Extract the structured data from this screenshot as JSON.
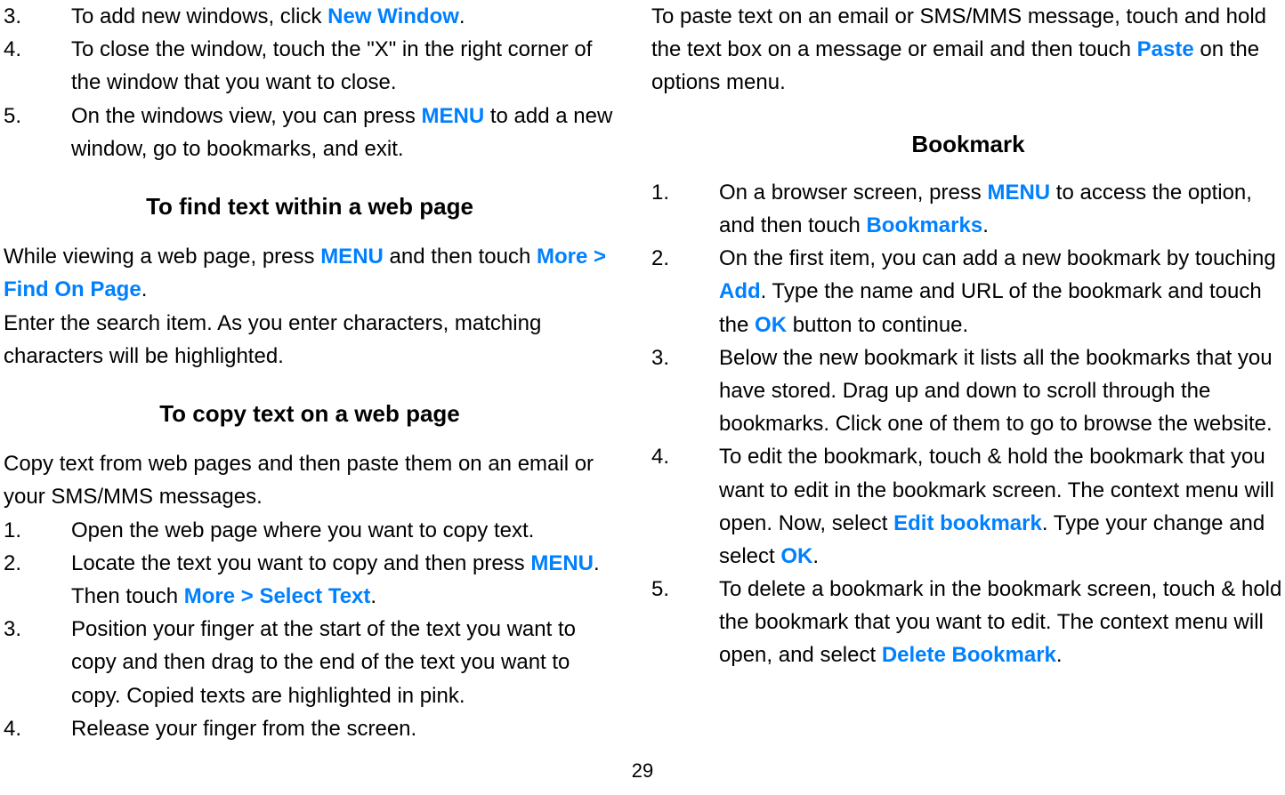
{
  "left": {
    "items_top": [
      {
        "num": "3.",
        "parts": [
          {
            "t": "To add new windows, click "
          },
          {
            "t": "New Window",
            "cls": "blue"
          },
          {
            "t": "."
          }
        ]
      },
      {
        "num": "4.",
        "parts": [
          {
            "t": "To close the window, touch the \"X\" in the right corner of the window that you want to close."
          }
        ]
      },
      {
        "num": "5.",
        "parts": [
          {
            "t": "On the windows view, you can press "
          },
          {
            "t": "MENU",
            "cls": "blue"
          },
          {
            "t": " to add a new window, go to bookmarks, and exit."
          }
        ]
      }
    ],
    "h_find": "To find text within a web page",
    "find_para1": [
      {
        "t": "While viewing a web page, press "
      },
      {
        "t": "MENU",
        "cls": "blue"
      },
      {
        "t": " and then touch "
      },
      {
        "t": "More > Find On Page",
        "cls": "blue"
      },
      {
        "t": "."
      }
    ],
    "find_para2": [
      {
        "t": "Enter the search item. As you enter characters, matching characters will be highlighted."
      }
    ],
    "h_copy": "To copy text on a web page",
    "copy_intro": [
      {
        "t": "Copy text from web pages and then paste them on an email or your SMS/MMS messages."
      }
    ],
    "copy_items": [
      {
        "num": "1.",
        "parts": [
          {
            "t": "Open the web page where you want to copy text."
          }
        ]
      },
      {
        "num": "2.",
        "parts": [
          {
            "t": "Locate the text you want to copy and then press "
          },
          {
            "t": "MENU",
            "cls": "blue"
          },
          {
            "t": ". Then touch "
          },
          {
            "t": "More > Select Text",
            "cls": "blue"
          },
          {
            "t": "."
          }
        ]
      },
      {
        "num": "3.",
        "parts": [
          {
            "t": "Position your finger at the start of the text you want to copy and then drag to the end of the text you want to copy. Copied texts are highlighted in pink."
          }
        ]
      },
      {
        "num": "4.",
        "parts": [
          {
            "t": "Release your finger from the screen."
          }
        ]
      }
    ]
  },
  "right": {
    "paste_para": [
      {
        "t": "To paste text on an email or SMS/MMS message, touch and hold the text box on a message or email and then touch "
      },
      {
        "t": "Paste",
        "cls": "blue"
      },
      {
        "t": " on the options menu."
      }
    ],
    "h_bookmark": "Bookmark",
    "bookmark_items": [
      {
        "num": "1.",
        "parts": [
          {
            "t": "On a browser screen, press "
          },
          {
            "t": "MENU",
            "cls": "blue"
          },
          {
            "t": " to access the option, and then touch "
          },
          {
            "t": "Bookmarks",
            "cls": "blue"
          },
          {
            "t": "."
          }
        ]
      },
      {
        "num": "2.",
        "parts": [
          {
            "t": "On the first item, you can add a new bookmark by touching "
          },
          {
            "t": "Add",
            "cls": "blue"
          },
          {
            "t": ". Type the name and URL of the bookmark and touch the "
          },
          {
            "t": "OK",
            "cls": "blue"
          },
          {
            "t": " button to continue."
          }
        ]
      },
      {
        "num": "3.",
        "parts": [
          {
            "t": "Below the new bookmark it lists all the bookmarks that you have stored. Drag up and down to scroll through the bookmarks. Click one of them to go to browse the website."
          }
        ]
      },
      {
        "num": "4.",
        "parts": [
          {
            "t": "To edit the bookmark, touch & hold the bookmark that you want to edit in the bookmark screen. The context menu will open. Now, select "
          },
          {
            "t": "Edit bookmark",
            "cls": "blue"
          },
          {
            "t": ". Type your change and select "
          },
          {
            "t": "OK",
            "cls": "blue"
          },
          {
            "t": "."
          }
        ]
      },
      {
        "num": "5.",
        "parts": [
          {
            "t": "To delete a bookmark in the bookmark screen, touch & hold the bookmark that you want to edit. The context menu will open, and select "
          },
          {
            "t": "Delete Bookmark",
            "cls": "blue"
          },
          {
            "t": "."
          }
        ]
      }
    ]
  },
  "page_number": "29"
}
